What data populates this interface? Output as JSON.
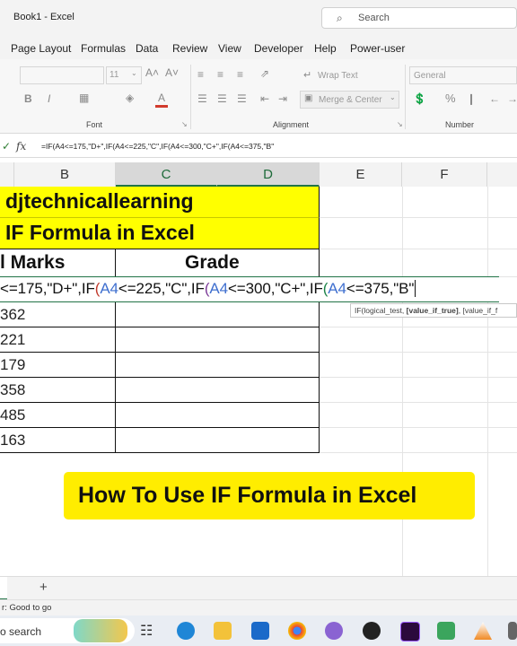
{
  "window": {
    "title": "Book1  -  Excel",
    "search_placeholder": "Search"
  },
  "menu_tabs": [
    "Page Layout",
    "Formulas",
    "Data",
    "Review",
    "View",
    "Developer",
    "Help",
    "Power-user"
  ],
  "ribbon": {
    "font_size": "11",
    "wrap_text": "Wrap Text",
    "merge_center": "Merge & Center",
    "number_format": "General",
    "bold": "B",
    "italic": "I",
    "font_color_letter": "A",
    "group_font": "Font",
    "group_alignment": "Alignment",
    "group_number": "Number",
    "percent": "%"
  },
  "formula_bar": {
    "fx": "fx",
    "formula": "=IF(A4<=175,\"D+\",IF(A4<=225,\"C\",IF(A4<=300,\"C+\",IF(A4<=375,\"B\""
  },
  "columns": [
    "B",
    "C",
    "D",
    "E",
    "F"
  ],
  "sheet": {
    "title1": "djtechnicallearning",
    "title2": "IF Formula in Excel",
    "header_marks": "l Marks",
    "header_grade": "Grade",
    "edit_parts": [
      "<=175,\"D+\",IF",
      "(",
      "A4",
      "<=225,\"C\",IF",
      "(",
      "A4",
      "<=300,\"C+\",IF",
      "(",
      "A4",
      "<=375,\"B\""
    ],
    "marks": [
      "362",
      "221",
      "179",
      "358",
      "485",
      "163"
    ],
    "tooltip_parts": [
      "IF(logical_test, ",
      "[value_if_true]",
      ", [value_if_f"
    ]
  },
  "banner": "How To Use IF Formula in Excel",
  "sheet_tabs": {
    "add": "+"
  },
  "status": "r: Good to go",
  "taskbar": {
    "search": "o search"
  },
  "colors": {
    "excel_green": "#217346",
    "highlight": "#ffff00",
    "banner": "#ffed00"
  }
}
